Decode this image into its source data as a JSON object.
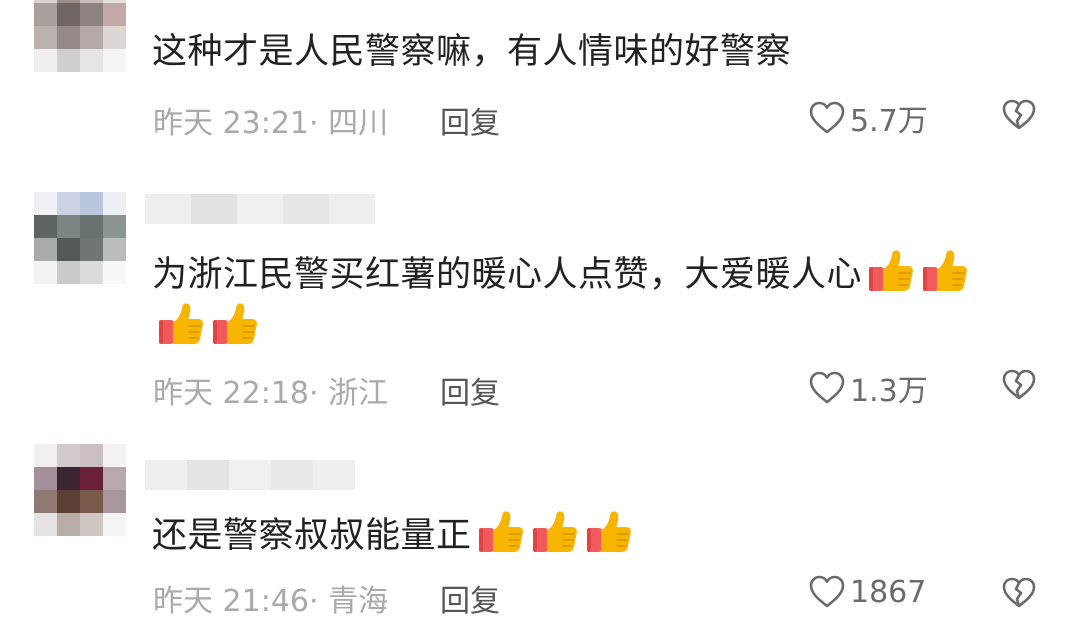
{
  "comments": [
    {
      "text": "这种才是人民警察嘛，有人情味的好警察",
      "text_line2": "",
      "thumbs": 0,
      "thumbs_line2": 0,
      "time": "昨天 23:21· 四川",
      "reply_label": "回复",
      "likes": "5.7万"
    },
    {
      "text": "为浙江民警买红薯的暖心人点赞，大爱暖人心",
      "text_line2": "",
      "thumbs": 2,
      "thumbs_line2": 2,
      "time": "昨天 22:18· 浙江",
      "reply_label": "回复",
      "likes": "1.3万"
    },
    {
      "text": "还是警察叔叔能量正",
      "text_line2": "",
      "thumbs": 3,
      "thumbs_line2": 0,
      "time": "昨天 21:46· 青海",
      "reply_label": "回复",
      "likes": "1867"
    }
  ],
  "icons": {
    "like": "heart-outline-icon",
    "dislike": "broken-heart-icon",
    "emoji": "thumbs-up-emoji"
  },
  "colors": {
    "text": "#222222",
    "meta": "#a9a9a9",
    "reply": "#555555",
    "icon": "#6a6a6a",
    "thumb": "#f7b500",
    "cuff": "#f15a5a"
  }
}
